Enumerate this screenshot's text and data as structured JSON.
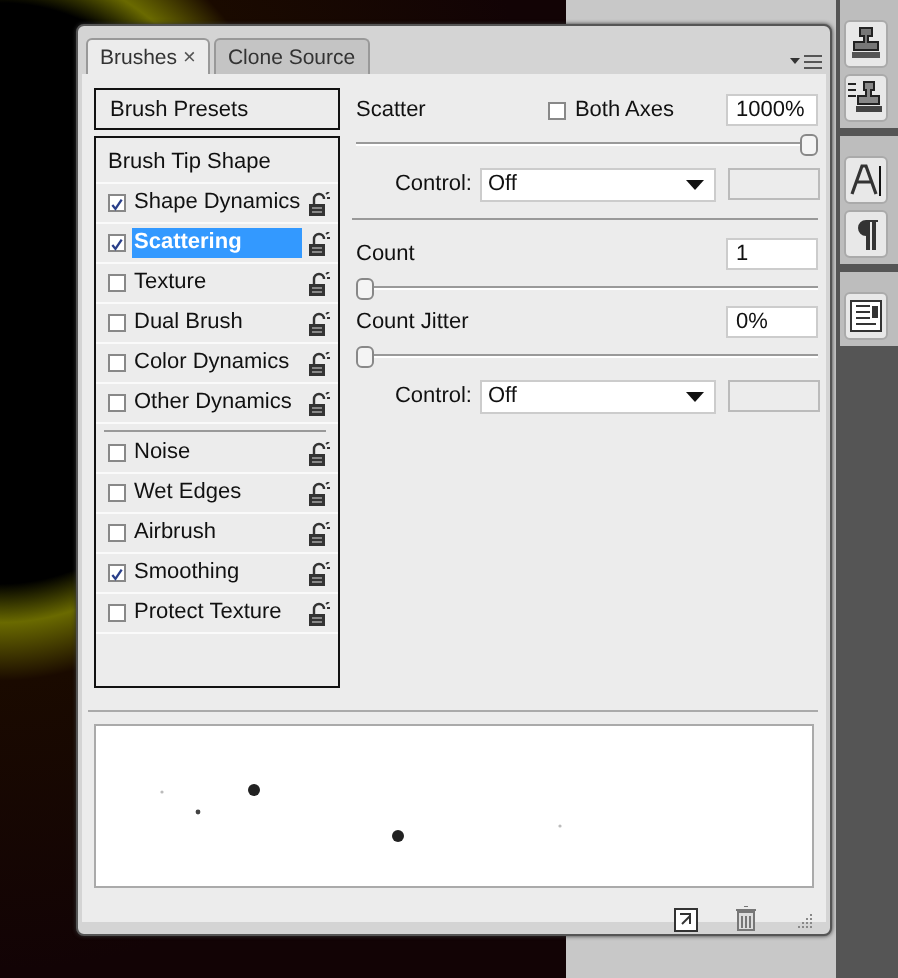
{
  "tabs": [
    {
      "label": "Brushes",
      "close": "×",
      "selected": true
    },
    {
      "label": "Clone Source",
      "selected": false
    }
  ],
  "sidebar": {
    "presets": "Brush Presets",
    "groups": [
      [
        {
          "kind": "heading",
          "label": "Brush Tip Shape",
          "selected": false
        },
        {
          "kind": "option",
          "label": "Shape Dynamics",
          "checked": true,
          "selected": false
        },
        {
          "kind": "option",
          "label": "Scattering",
          "checked": true,
          "selected": true
        },
        {
          "kind": "option",
          "label": "Texture",
          "checked": false,
          "selected": false
        },
        {
          "kind": "option",
          "label": "Dual Brush",
          "checked": false,
          "selected": false
        },
        {
          "kind": "option",
          "label": "Color Dynamics",
          "checked": false,
          "selected": false
        },
        {
          "kind": "option",
          "label": "Other Dynamics",
          "checked": false,
          "selected": false
        }
      ],
      [
        {
          "kind": "option",
          "label": "Noise",
          "checked": false,
          "selected": false
        },
        {
          "kind": "option",
          "label": "Wet Edges",
          "checked": false,
          "selected": false
        },
        {
          "kind": "option",
          "label": "Airbrush",
          "checked": false,
          "selected": false
        },
        {
          "kind": "option",
          "label": "Smoothing",
          "checked": true,
          "selected": false
        },
        {
          "kind": "option",
          "label": "Protect Texture",
          "checked": false,
          "selected": false
        }
      ]
    ]
  },
  "settings": [
    {
      "kind": "slider",
      "label": "Scatter",
      "toggle": {
        "label": "Both Axes",
        "checked": false
      },
      "value": "1000%",
      "level": 1
    },
    {
      "kind": "control",
      "label": "Control:",
      "value": "Off"
    },
    {
      "kind": "divider"
    },
    {
      "kind": "slider",
      "label": "Count",
      "value": "1",
      "level": 0
    },
    {
      "kind": "slider",
      "label": "Count Jitter",
      "value": "0%",
      "level": 0
    },
    {
      "kind": "control",
      "label": "Control:",
      "value": "Off"
    }
  ]
}
